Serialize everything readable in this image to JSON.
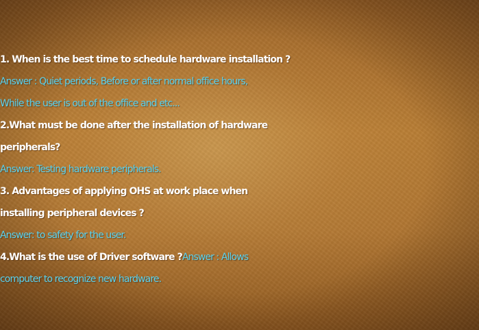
{
  "slide": {
    "lines": [
      {
        "q": " 1. When is the best time to schedule hardware installation ?"
      },
      {
        "a": " Answer : Quiet periods, Before or after normal office hours,"
      },
      {
        "a": "While the user is out of the office and etc..."
      },
      {
        "q": " 2.What must be done after the installation of hardware"
      },
      {
        "q": "peripherals?"
      },
      {
        "a": "Answer: Testing hardware peripherals."
      },
      {
        "q": " 3. Advantages of applying OHS at work place when"
      },
      {
        "q": "installing peripheral devices ?"
      },
      {
        "a": "Answer: to safety for the user."
      },
      {
        "q": "4.What is the use of Driver software ?",
        "a": "Answer : Allows"
      },
      {
        "a": "computer to recognize new hardware."
      }
    ]
  }
}
